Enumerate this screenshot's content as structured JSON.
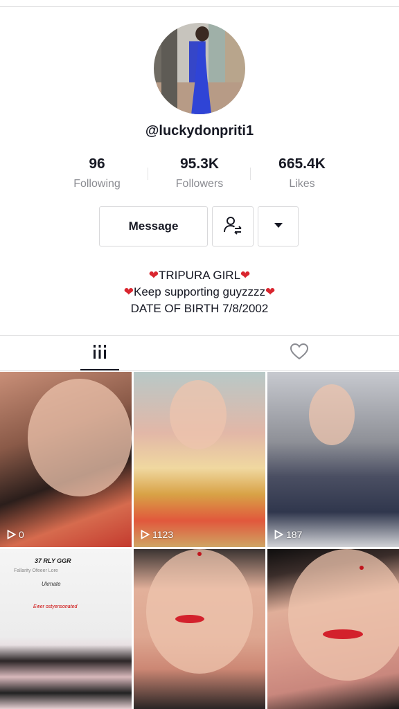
{
  "profile": {
    "username": "@luckydonpriti1",
    "following_count": "96",
    "following_label": "Following",
    "followers_count": "95.3K",
    "followers_label": "Followers",
    "likes_count": "665.4K",
    "likes_label": "Likes"
  },
  "actions": {
    "message_label": "Message",
    "follow_icon": "person-swap-icon",
    "more_icon": "caret-down-icon"
  },
  "bio": {
    "line1": "TRIPURA GIRL",
    "line2": "Keep supporting guyzzzz",
    "line3": "DATE OF BIRTH 7/8/2002",
    "heart_color": "#d9262f"
  },
  "tabs": {
    "videos_icon": "grid-icon",
    "liked_icon": "heart-outline-icon"
  },
  "videos": [
    {
      "views": "0"
    },
    {
      "views": "1123"
    },
    {
      "views": "187"
    }
  ],
  "t4_texts": [
    "37 RLY GGR",
    "Fallarity   Ofeeer   Lore",
    "Ukmate",
    "Ewer ostyensonated"
  ]
}
